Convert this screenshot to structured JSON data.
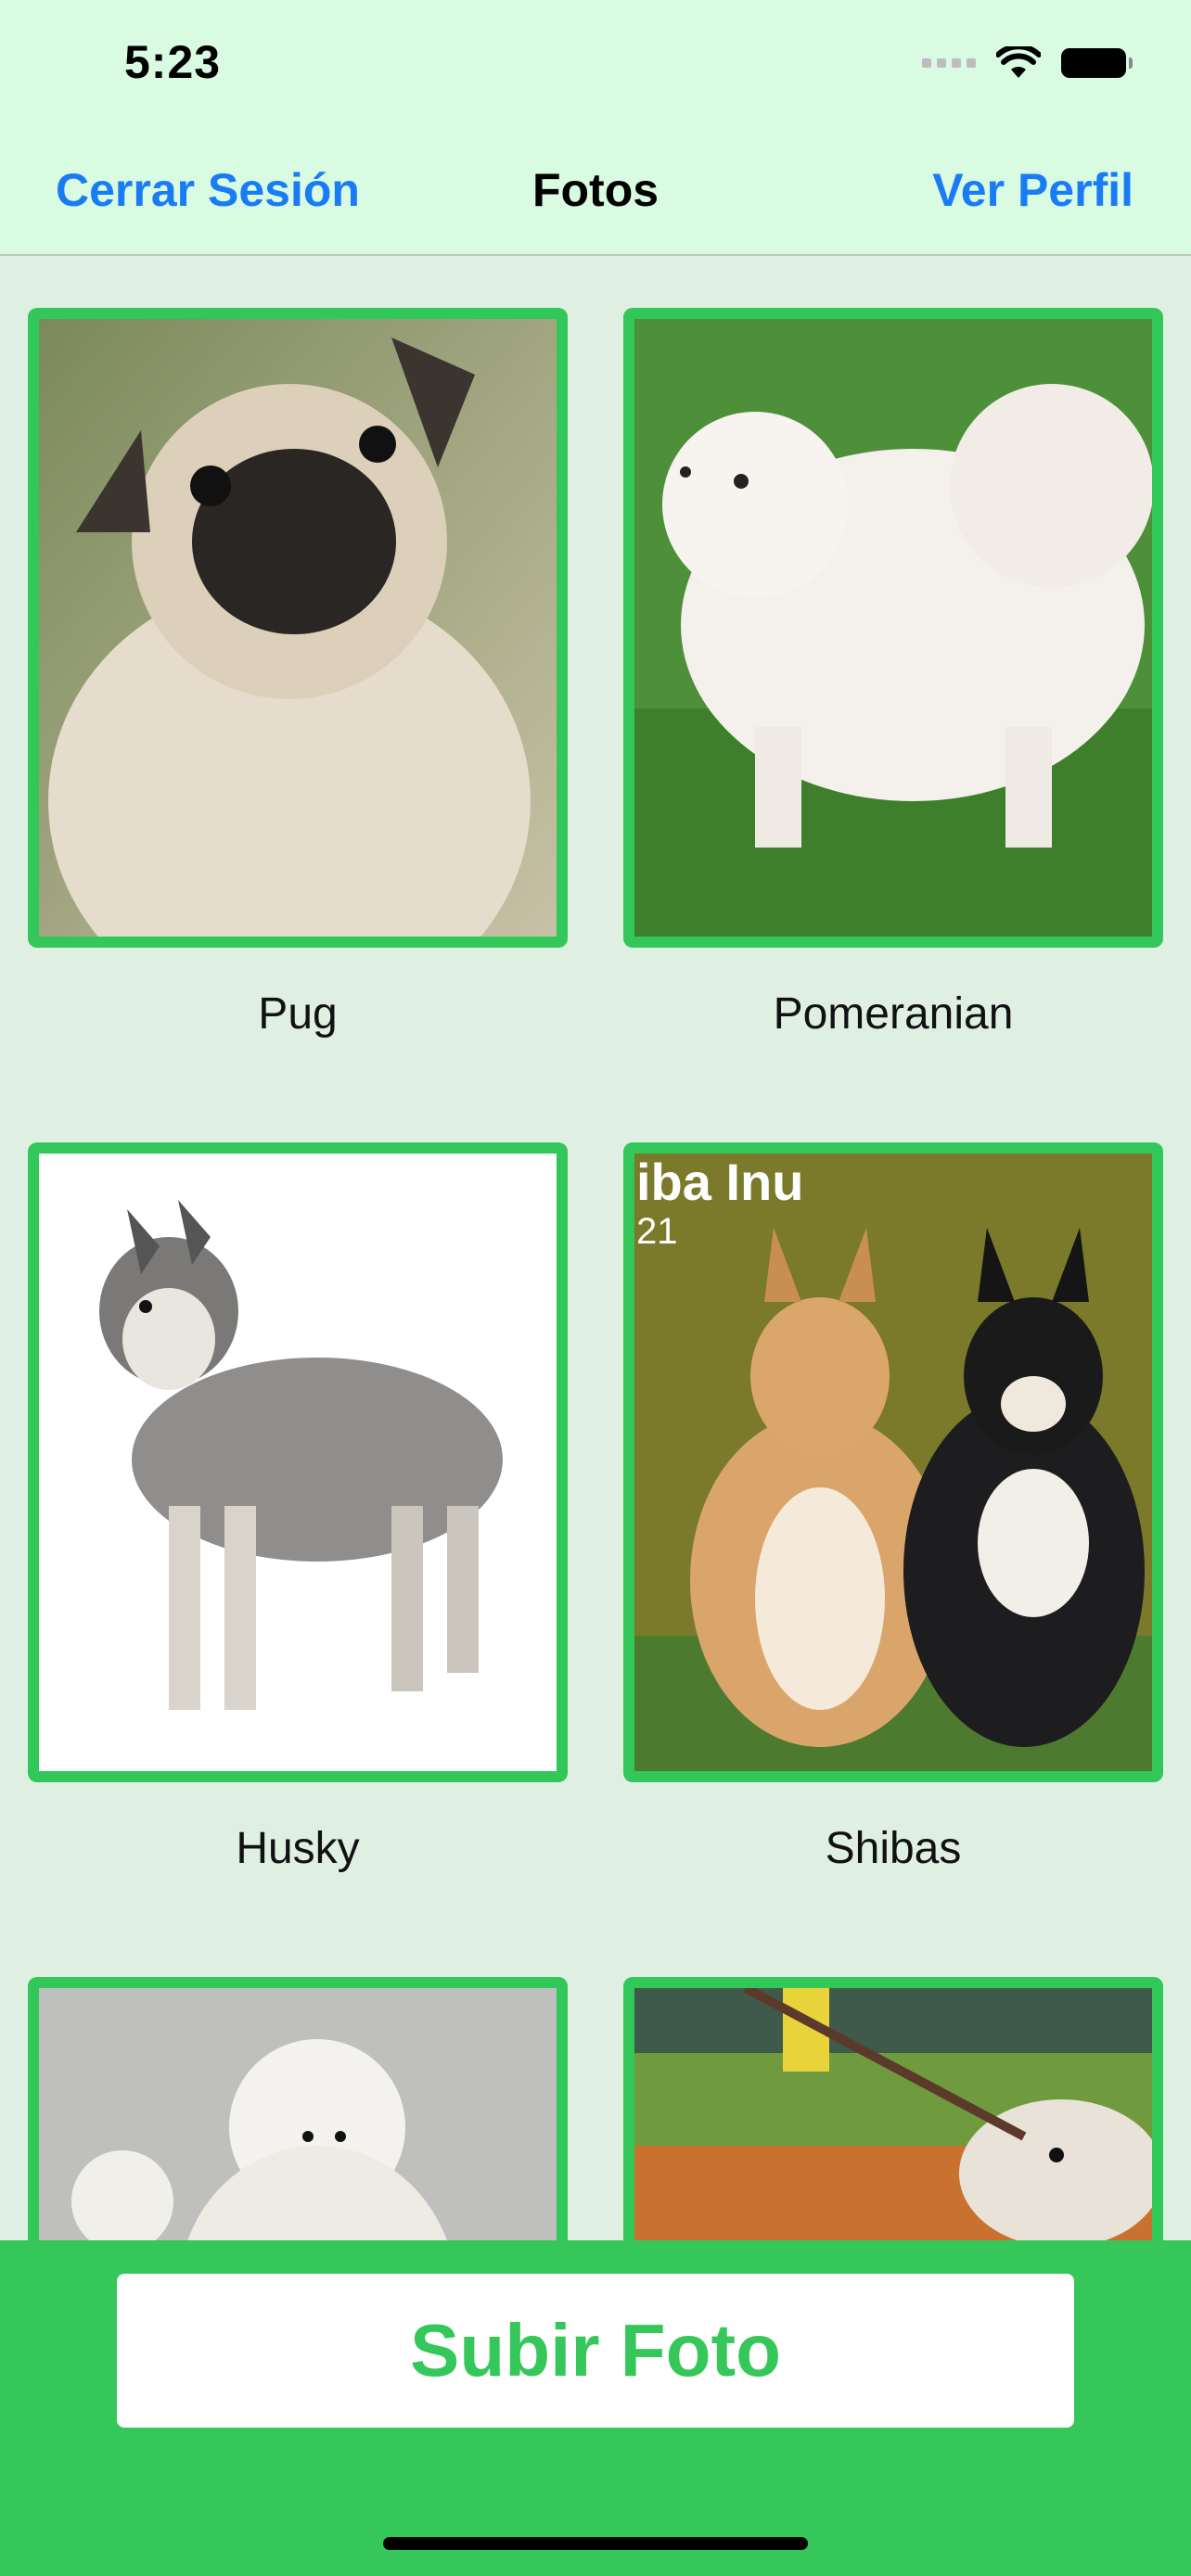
{
  "status_bar": {
    "time": "5:23"
  },
  "nav": {
    "left_label": "Cerrar Sesión",
    "title": "Fotos",
    "right_label": "Ver Perfil"
  },
  "photos": [
    {
      "caption": "Pug"
    },
    {
      "caption": "Pomeranian"
    },
    {
      "caption": "Husky"
    },
    {
      "caption": "Shibas",
      "overlay_text": "iba Inu",
      "overlay_sub": "21"
    },
    {
      "caption": ""
    },
    {
      "caption": ""
    }
  ],
  "upload": {
    "label": "Subir Foto"
  },
  "colors": {
    "accent": "#35c759",
    "link": "#1a7cf5",
    "background": "#dff0e3",
    "header": "#d9fbe1"
  }
}
